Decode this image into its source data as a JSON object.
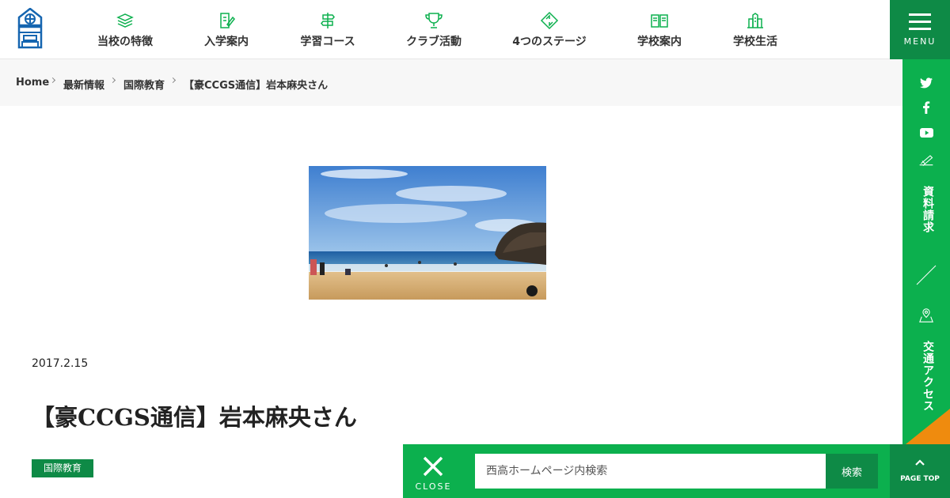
{
  "header": {
    "nav": [
      {
        "label": "当校の特徴",
        "icon": "stack-icon"
      },
      {
        "label": "入学案内",
        "icon": "pen-paper-icon"
      },
      {
        "label": "学習コース",
        "icon": "signpost-icon"
      },
      {
        "label": "クラブ活動",
        "icon": "trophy-icon"
      },
      {
        "label": "4つのステージ",
        "icon": "diamond-arrows-icon"
      },
      {
        "label": "学校案内",
        "icon": "open-book-icon"
      },
      {
        "label": "学校生活",
        "icon": "school-building-icon"
      }
    ],
    "menu_label": "MENU"
  },
  "breadcrumb": {
    "home": "Home",
    "news": "最新情報",
    "category": "国際教育",
    "current": "【豪CCGS通信】岩本麻央さん"
  },
  "sidebar": {
    "request_label": "資料請求",
    "access_label": "交通アクセス"
  },
  "post": {
    "date": "2017.2.15",
    "title": "【豪CCGS通信】岩本麻央さん",
    "tag": "国際教育"
  },
  "search": {
    "close_label": "CLOSE",
    "placeholder": "西高ホームページ内検索",
    "button_label": "検索"
  },
  "pagetop_label": "PAGE TOP",
  "colors": {
    "brand_green": "#0cb04e",
    "dark_green": "#0e8a46",
    "accent_orange": "#ef8b0e"
  }
}
